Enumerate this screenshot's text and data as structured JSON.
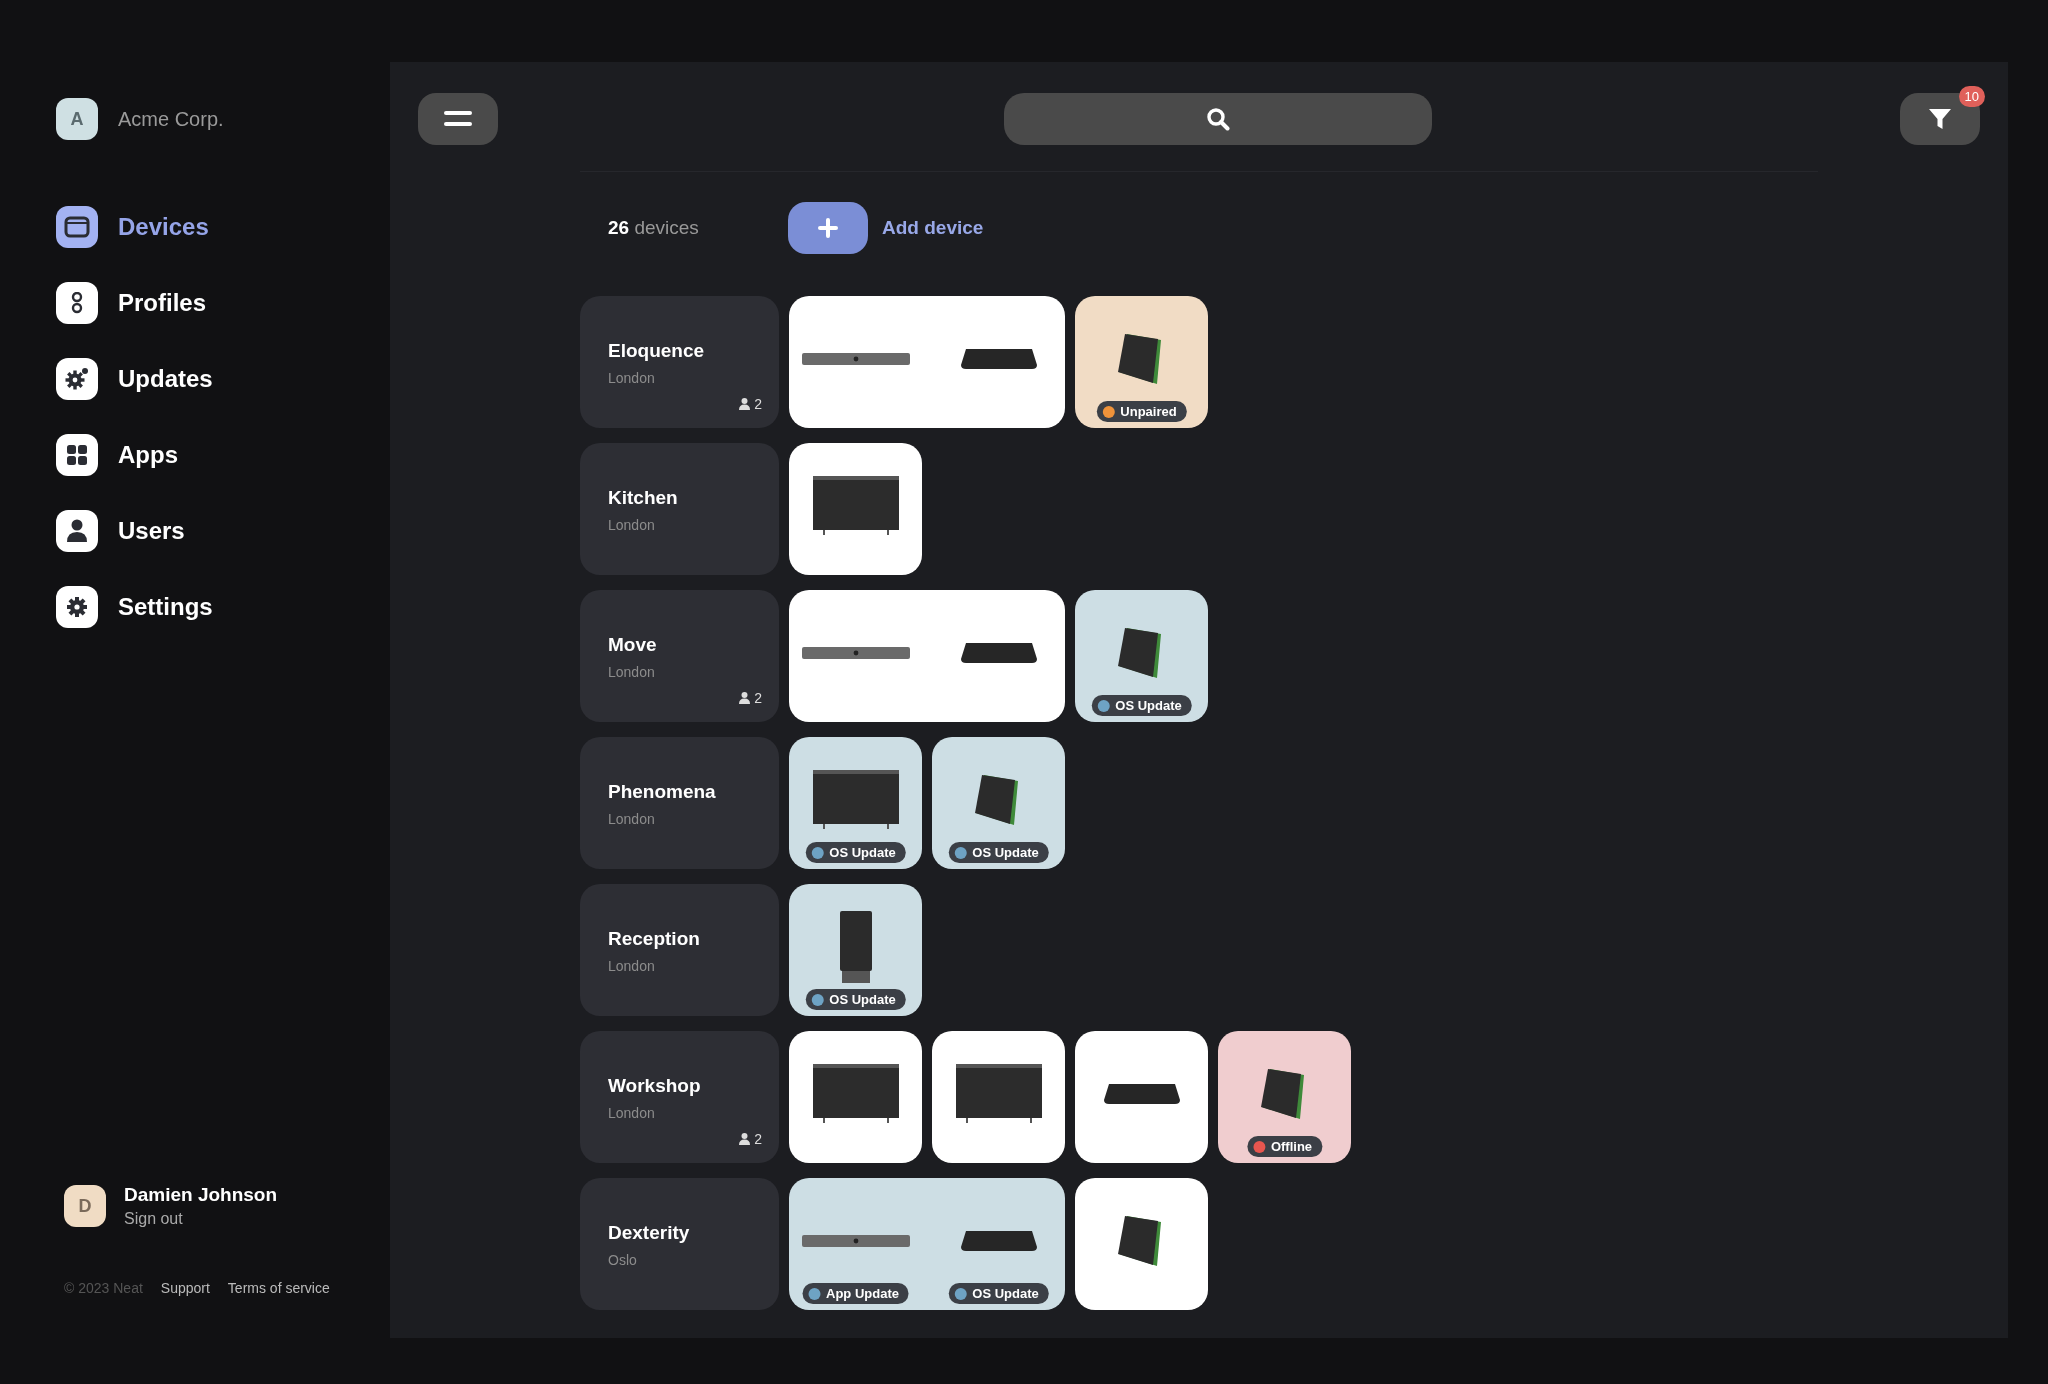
{
  "org": {
    "initial": "A",
    "name": "Acme Corp."
  },
  "nav": [
    {
      "label": "Devices",
      "kind": "device",
      "selected": true
    },
    {
      "label": "Profiles",
      "kind": "profiles",
      "selected": false
    },
    {
      "label": "Updates",
      "kind": "updates",
      "selected": false
    },
    {
      "label": "Apps",
      "kind": "apps",
      "selected": false
    },
    {
      "label": "Users",
      "kind": "user",
      "selected": false
    },
    {
      "label": "Settings",
      "kind": "settings",
      "selected": false
    }
  ],
  "user": {
    "initial": "D",
    "name": "Damien Johnson",
    "action": "Sign out"
  },
  "footer": {
    "copyright": "© 2023 Neat",
    "links": [
      "Support",
      "Terms of service"
    ]
  },
  "filter_count": "10",
  "summary": {
    "count": "26",
    "unit": "devices",
    "add_label": "Add device"
  },
  "rooms": [
    {
      "name": "Eloquence",
      "location": "London",
      "users": "2",
      "tiles": [
        {
          "color": "#ffffff",
          "devices": [
            {
              "kind": "bar"
            },
            {
              "kind": "box"
            }
          ]
        },
        {
          "color": "#f1dcc5",
          "devices": [
            {
              "kind": "tablet",
              "badge": {
                "label": "Unpaired",
                "color": "#f0933a"
              }
            }
          ]
        }
      ]
    },
    {
      "name": "Kitchen",
      "location": "London",
      "tiles": [
        {
          "color": "#ffffff",
          "devices": [
            {
              "kind": "tv"
            }
          ]
        }
      ]
    },
    {
      "name": "Move",
      "location": "London",
      "users": "2",
      "tiles": [
        {
          "color": "#ffffff",
          "devices": [
            {
              "kind": "bar"
            },
            {
              "kind": "box"
            }
          ]
        },
        {
          "color": "#cddee4",
          "devices": [
            {
              "kind": "tablet",
              "badge": {
                "label": "OS Update",
                "color": "#6ea3c4"
              }
            }
          ]
        }
      ]
    },
    {
      "name": "Phenomena",
      "location": "London",
      "tiles": [
        {
          "color": "#cddee4",
          "devices": [
            {
              "kind": "tv",
              "badge": {
                "label": "OS Update",
                "color": "#6ea3c4"
              }
            }
          ]
        },
        {
          "color": "#cddee4",
          "devices": [
            {
              "kind": "tablet",
              "badge": {
                "label": "OS Update",
                "color": "#6ea3c4"
              }
            }
          ]
        }
      ]
    },
    {
      "name": "Reception",
      "location": "London",
      "tiles": [
        {
          "color": "#cddee4",
          "devices": [
            {
              "kind": "tower",
              "badge": {
                "label": "OS Update",
                "color": "#6ea3c4"
              }
            }
          ]
        }
      ]
    },
    {
      "name": "Workshop",
      "location": "London",
      "users": "2",
      "tiles": [
        {
          "color": "#ffffff",
          "devices": [
            {
              "kind": "tv"
            }
          ]
        },
        {
          "color": "#ffffff",
          "devices": [
            {
              "kind": "tv"
            }
          ]
        },
        {
          "color": "#ffffff",
          "devices": [
            {
              "kind": "box"
            }
          ]
        },
        {
          "color": "#f0cdcf",
          "devices": [
            {
              "kind": "tablet",
              "badge": {
                "label": "Offline",
                "color": "#e8564f"
              }
            }
          ]
        }
      ]
    },
    {
      "name": "Dexterity",
      "location": "Oslo",
      "tiles": [
        {
          "color": "#cddee4",
          "devices": [
            {
              "kind": "bar",
              "badge": {
                "label": "App Update",
                "color": "#6ea3c4"
              }
            },
            {
              "kind": "box",
              "badge": {
                "label": "OS Update",
                "color": "#6ea3c4"
              }
            }
          ]
        },
        {
          "color": "#ffffff",
          "devices": [
            {
              "kind": "tablet"
            }
          ]
        }
      ]
    }
  ]
}
